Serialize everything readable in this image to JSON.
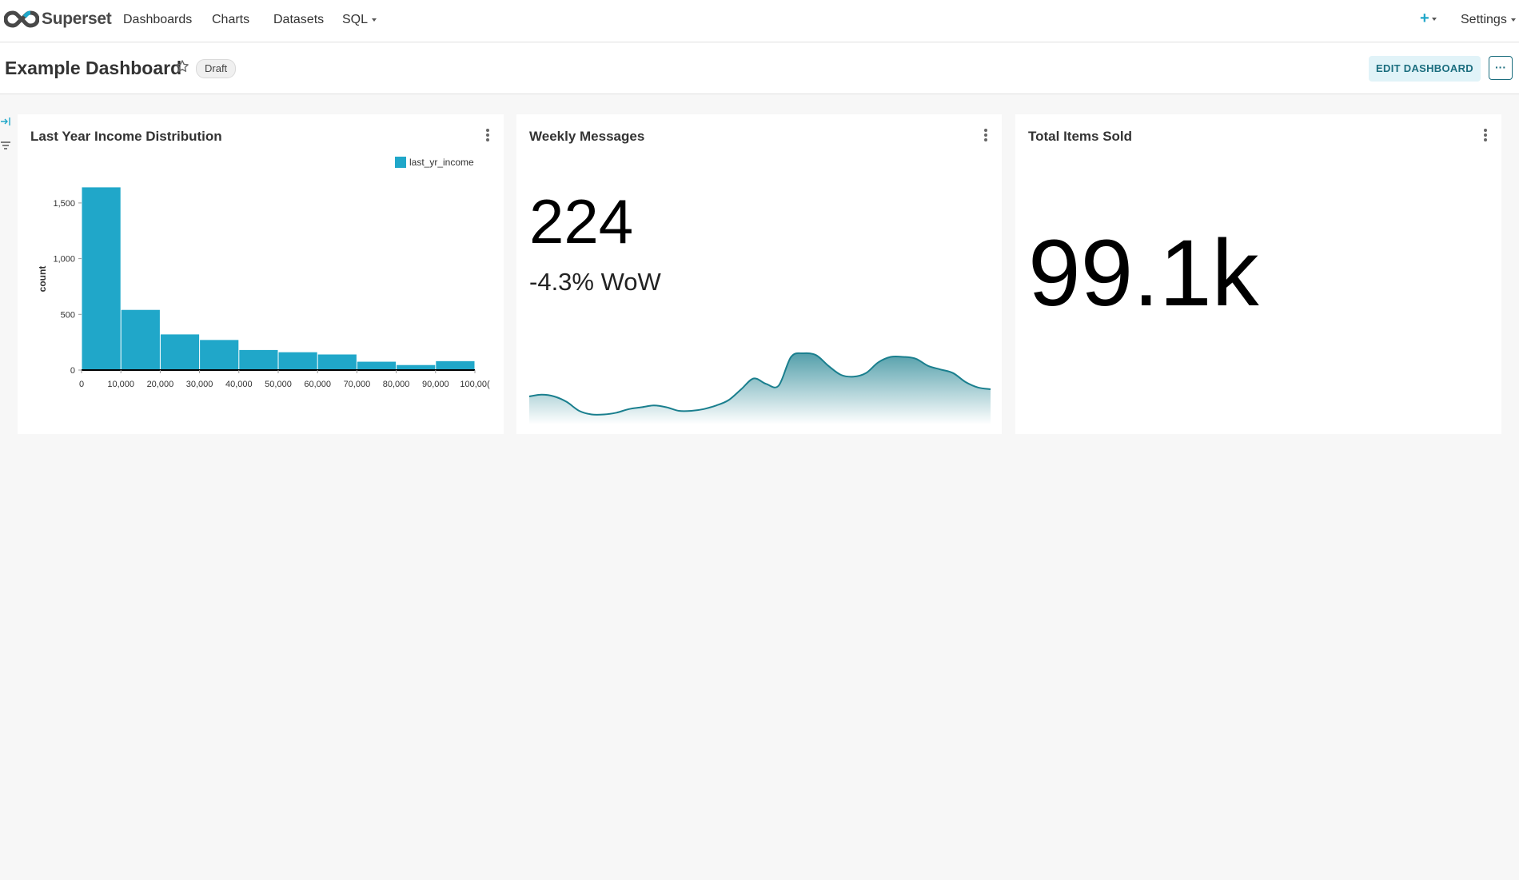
{
  "nav": {
    "brand": "Superset",
    "items": [
      "Dashboards",
      "Charts",
      "Datasets",
      "SQL"
    ],
    "plus": "+",
    "settings": "Settings"
  },
  "header": {
    "title": "Example Dashboard",
    "status": "Draft",
    "edit_label": "EDIT DASHBOARD",
    "more_label": "···"
  },
  "cards": [
    {
      "title": "Last Year Income Distribution"
    },
    {
      "title": "Weekly Messages",
      "value": "224",
      "subheader": "-4.3% WoW"
    },
    {
      "title": "Total Items Sold",
      "value": "99.1k"
    }
  ],
  "colors": {
    "accent": "#20a7c9",
    "teal": "#1c6e7f",
    "bar": "#20a7c9",
    "line": "#1a7f8e"
  },
  "chart_data": [
    {
      "type": "bar",
      "title": "Last Year Income Distribution",
      "legend": [
        "last_yr_income"
      ],
      "ylabel": "count",
      "xlabel": "",
      "x_ticks": [
        "0",
        "10,000",
        "20,000",
        "30,000",
        "40,000",
        "50,000",
        "60,000",
        "70,000",
        "80,000",
        "90,000",
        "100,00("
      ],
      "y_ticks": [
        "0",
        "500",
        "1,000",
        "1,500"
      ],
      "bin_edges": [
        0,
        10000,
        20000,
        30000,
        40000,
        50000,
        60000,
        70000,
        80000,
        90000,
        100000
      ],
      "values": [
        1640,
        540,
        320,
        270,
        180,
        160,
        140,
        75,
        45,
        80
      ],
      "ylim": [
        0,
        1650
      ]
    },
    {
      "type": "area",
      "title": "Weekly Messages",
      "y": [
        12,
        13,
        12,
        9,
        4,
        2,
        2,
        3,
        5,
        6,
        7,
        6,
        4,
        4,
        5,
        7,
        10,
        16,
        22,
        19,
        18,
        34,
        36,
        35,
        29,
        24,
        23,
        25,
        31,
        34,
        34,
        33,
        29,
        27,
        25,
        20,
        17,
        16
      ],
      "ylim": [
        0,
        40
      ]
    }
  ]
}
